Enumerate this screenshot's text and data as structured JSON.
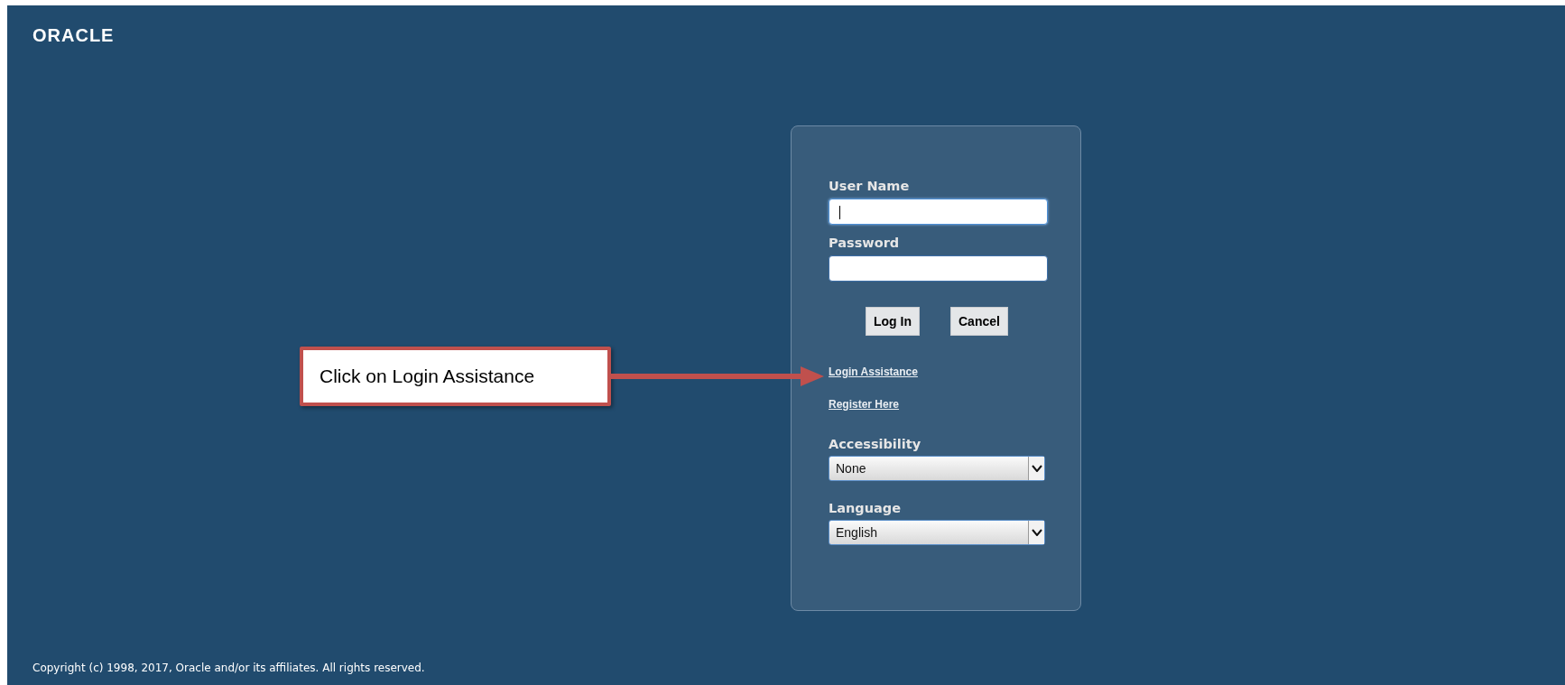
{
  "logo": "ORACLE",
  "login_form": {
    "fields": [
      {
        "label": "User Name",
        "focused": true
      },
      {
        "label": "Password",
        "focused": false
      }
    ],
    "buttons": [
      "Log In",
      "Cancel"
    ],
    "links": [
      "Login Assistance",
      "Register Here"
    ],
    "selects": [
      {
        "label": "Accessibility",
        "value": "None"
      },
      {
        "label": "Language",
        "value": "English"
      }
    ]
  },
  "callout": {
    "text": "Click on Login Assistance"
  },
  "copyright": "Copyright (c) 1998, 2017, Oracle and/or its affiliates. All rights reserved."
}
